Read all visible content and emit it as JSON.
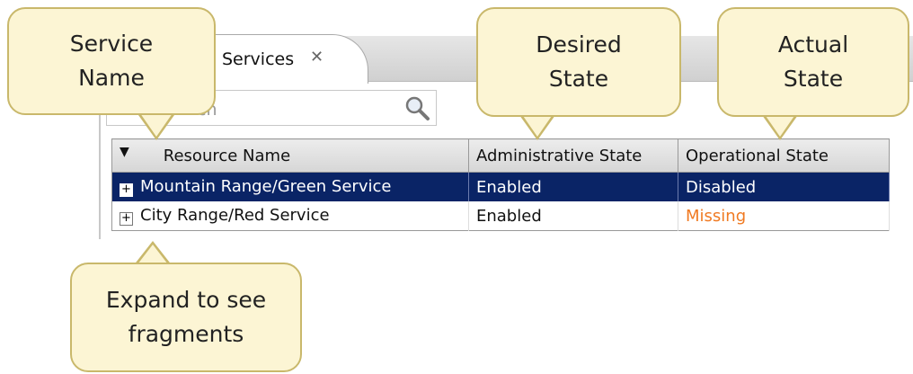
{
  "tab": {
    "label": "Services"
  },
  "search": {
    "placeholder": "ch"
  },
  "table": {
    "columns": [
      "Resource Name",
      "Administrative State",
      "Operational State"
    ],
    "rows": [
      {
        "name": "Mountain Range/Green Service",
        "admin": "Enabled",
        "oper": "Disabled",
        "selected": true
      },
      {
        "name": "City Range/Red Service",
        "admin": "Enabled",
        "oper": "Missing",
        "selected": false
      }
    ]
  },
  "callouts": {
    "service_name": "Service Name",
    "desired_state": "Desired State",
    "actual_state": "Actual State",
    "expand": "Expand to see fragments"
  },
  "colors": {
    "selected_row": "#0a2466",
    "missing": "#f07a22",
    "callout_fill": "#fcf5d4"
  }
}
